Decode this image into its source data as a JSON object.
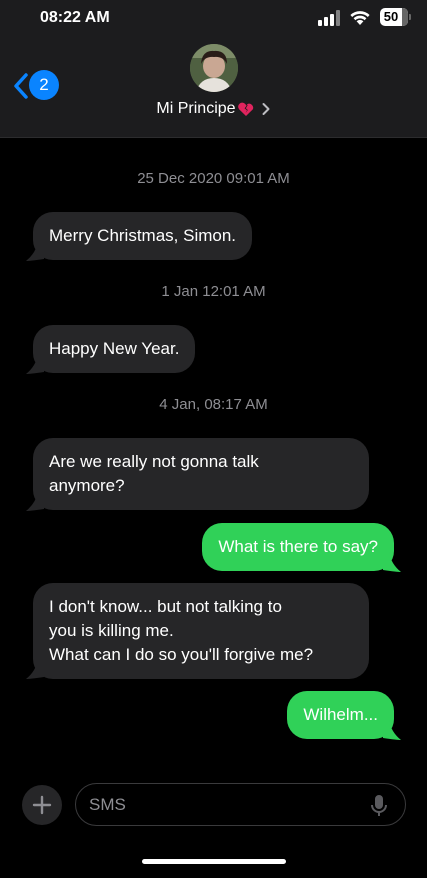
{
  "status_bar": {
    "time": "08:22 AM",
    "battery": "50"
  },
  "header": {
    "back_badge": "2",
    "contact_name": "Mi Principe",
    "icons": [
      "back-chevron-icon",
      "avatar",
      "broken-heart-icon",
      "chevron-right-icon"
    ]
  },
  "conversation": {
    "timestamps": [
      "25 Dec 2020 09:01 AM",
      "1 Jan 12:01 AM",
      "4 Jan, 08:17 AM"
    ],
    "messages": [
      {
        "direction": "incoming",
        "text": "Merry Christmas, Simon."
      },
      {
        "direction": "incoming",
        "text": "Happy New Year."
      },
      {
        "direction": "incoming",
        "line1": "Are we really not gonna talk",
        "line2": "anymore?"
      },
      {
        "direction": "outgoing",
        "text": "What is there to say?"
      },
      {
        "direction": "incoming",
        "line1": "I don't know... but not talking to",
        "line2": "you is killing me.",
        "line3": "What can I do so you'll forgive me?"
      },
      {
        "direction": "outgoing",
        "text": "Wilhelm..."
      }
    ]
  },
  "composer": {
    "placeholder": "SMS",
    "icons": [
      "plus-icon",
      "microphone-icon"
    ]
  },
  "colors": {
    "background": "#000000",
    "header": "#1c1c1e",
    "incoming_bubble": "#262628",
    "outgoing_bubble": "#30d158",
    "accent": "#0a84ff",
    "timestamp": "#8e8e93"
  }
}
